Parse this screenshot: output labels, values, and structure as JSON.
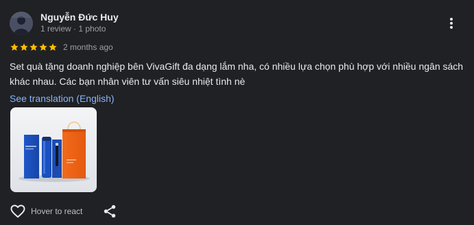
{
  "review": {
    "author_name": "Nguyễn Đức Huy",
    "author_meta": "1 review · 1 photo",
    "rating": 5,
    "date": "2 months ago",
    "text": "Set quà tặng doanh nghiệp bên VivaGift đa dạng lắm nha, có nhiều lựa chọn phù hợp với nhiều ngân sách khác nhau. Các bạn nhân viên tư vấn siêu nhiệt tình nè",
    "translation_link": "See translation (English)"
  },
  "actions": {
    "react_label": "Hover to react"
  },
  "icons": {
    "more": "more-vert-icon",
    "heart": "heart-icon",
    "share": "share-icon",
    "star": "star-icon"
  },
  "colors": {
    "background": "#202124",
    "star": "#fbbc04",
    "link": "#8ab4f8",
    "secondary_text": "#9aa0a6"
  }
}
